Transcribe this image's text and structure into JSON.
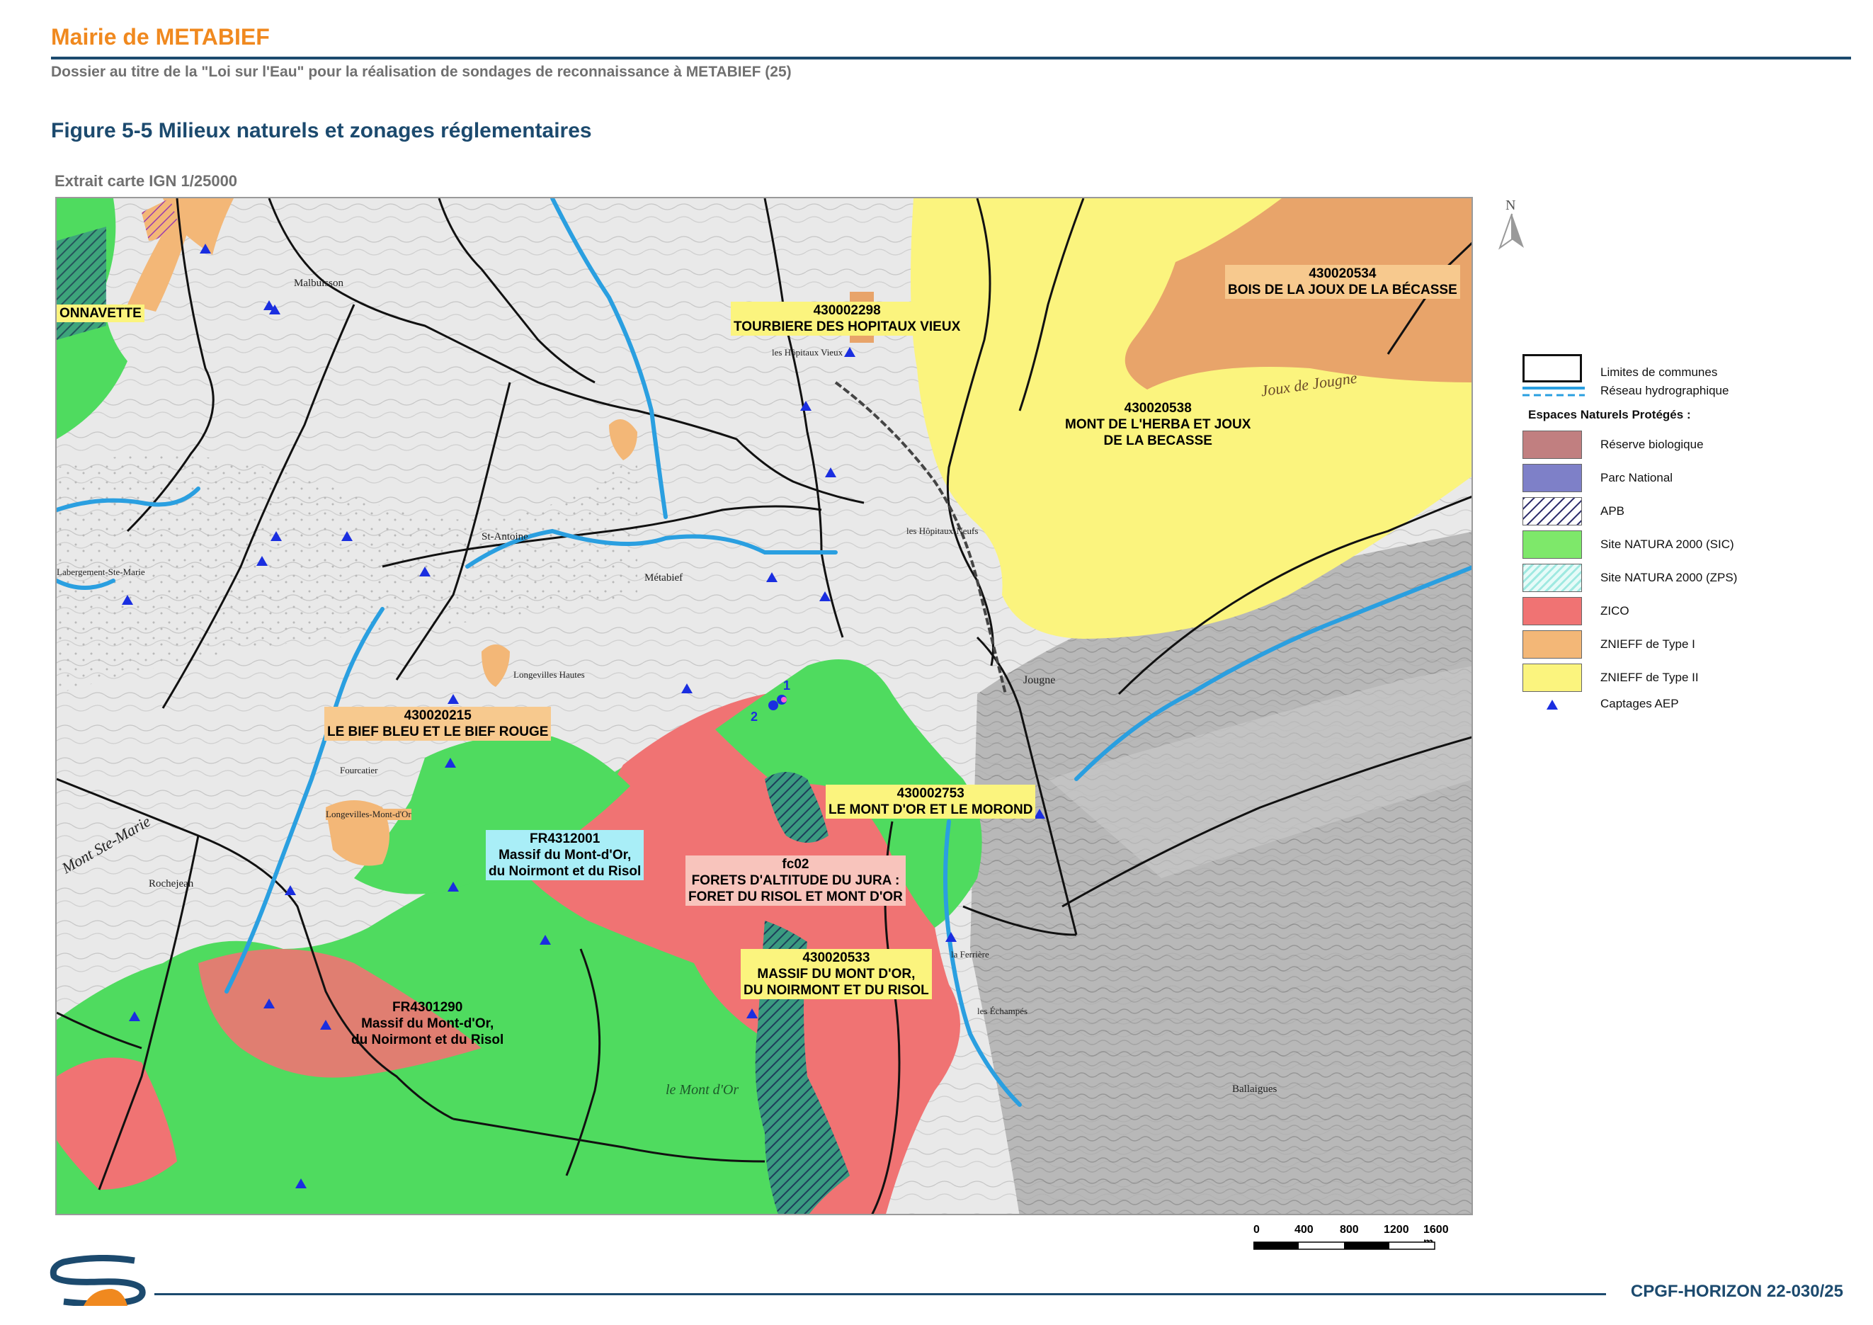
{
  "header": {
    "title": "Mairie de METABIEF",
    "subtitle": "Dossier au titre de la \"Loi sur l'Eau\" pour la réalisation de sondages de reconnaissance à METABIEF (25)"
  },
  "figure": {
    "title": "Figure 5-5 Milieux naturels et zonages réglementaires",
    "extract": "Extrait carte IGN 1/25000"
  },
  "map": {
    "zone_labels": {
      "onnavette": "ONNAVETTE",
      "z430002298_code": "430002298",
      "z430002298_name": "TOURBIERE DES HOPITAUX VIEUX",
      "z430020534_code": "430020534",
      "z430020534_name": "BOIS DE LA JOUX DE LA BÉCASSE",
      "z430020538_code": "430020538",
      "z430020538_name1": "MONT DE L'HERBA ET JOUX",
      "z430020538_name2": "DE LA BECASSE",
      "z430020215_code": "430020215",
      "z430020215_name": "LE BIEF BLEU ET LE BIEF ROUGE",
      "z430002753_code": "430002753",
      "z430002753_name": "LE MONT D'OR ET LE MOROND",
      "fr4312001_code": "FR4312001",
      "fr4312001_name1": "Massif du Mont-d'Or,",
      "fr4312001_name2": "du Noirmont et du Risol",
      "fc02_code": "fc02",
      "fc02_name1": "FORETS D'ALTITUDE DU JURA :",
      "fc02_name2": "FORET DU RISOL ET MONT D'OR",
      "z430020533_code": "430020533",
      "z430020533_name1": "MASSIF DU MONT D'OR,",
      "z430020533_name2": "DU NOIRMONT ET DU RISOL",
      "fr4301290_code": "FR4301290",
      "fr4301290_name1": "Massif du Mont-d'Or,",
      "fr4301290_name2": "du Noirmont et du Risol"
    },
    "places": {
      "metabief": "Métabief",
      "jougne": "Jougne",
      "st_antoine": "St-Antoine",
      "les_hopitaux_vieux": "les Hôpitaux Vieux",
      "les_hopitaux_neufs": "les Hôpitaux-Neufs",
      "malbuisson": "Malbuisson",
      "rochejean": "Rochejean",
      "longevilles_hautes": "Longevilles Hautes",
      "longevilles_mont_dor": "Longevilles-Mont-d'Or",
      "fourcatier": "Fourcatier",
      "labergement": "Labergement-Ste-Marie",
      "la_ferriere": "la Ferrière",
      "les_echampes": "les Échampés",
      "ballaigues": "Ballaigues",
      "joux_de_jougne": "Joux de Jougne",
      "mont_ste_marie": "Mont Ste-Marie",
      "le_mont_dor": "le Mont d'Or",
      "captage1": "1",
      "captage2": "2"
    }
  },
  "north_label": "N",
  "legend": {
    "items": [
      {
        "label": "Limites de communes"
      },
      {
        "label": "Réseau hydrographique"
      },
      {
        "label": "Espaces Naturels Protégés :"
      },
      {
        "label": "Réserve biologique"
      },
      {
        "label": "Parc National"
      },
      {
        "label": "APB"
      },
      {
        "label": "Site NATURA 2000 (SIC)"
      },
      {
        "label": "Site NATURA 2000 (ZPS)"
      },
      {
        "label": "ZICO"
      },
      {
        "label": "ZNIEFF de Type I"
      },
      {
        "label": "ZNIEFF de Type II"
      },
      {
        "label": "Captages AEP"
      }
    ],
    "colors": {
      "reserve": "#c17f80",
      "parc": "#7e80c8",
      "sic": "#7ee86a",
      "zps": "#c9f3ef",
      "zico": "#f07373",
      "znieff1": "#f3b777",
      "znieff2": "#fbf47e",
      "captage": "#1a2ee0",
      "water": "#2a9fe0"
    }
  },
  "scale": {
    "ticks": [
      "0",
      "400",
      "800",
      "1200",
      "1600 m"
    ]
  },
  "footer": {
    "code": "CPGF-HORIZON 22-030/25"
  }
}
